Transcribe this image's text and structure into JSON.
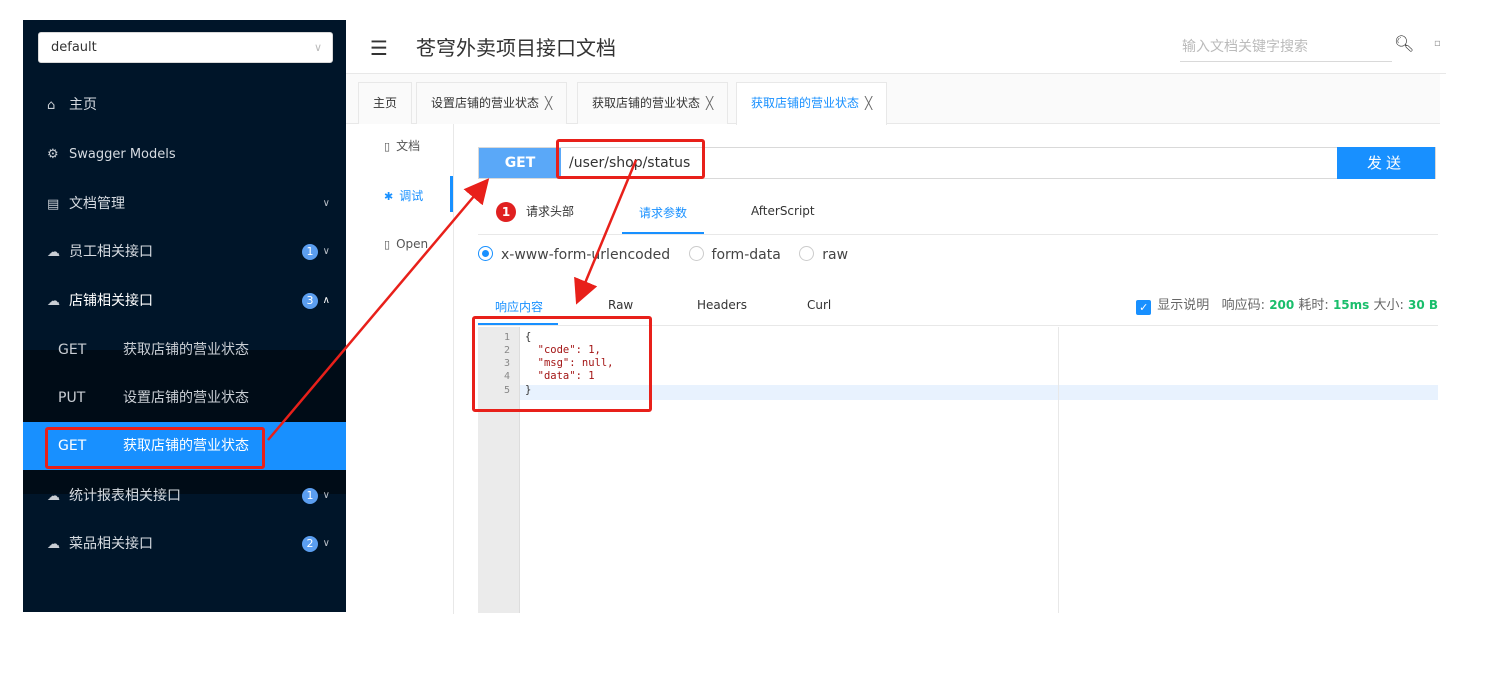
{
  "sidebar": {
    "group_select": "default",
    "menu": [
      {
        "label": "主页"
      },
      {
        "label": "Swagger Models"
      },
      {
        "label": "文档管理"
      },
      {
        "label": "员工相关接口",
        "badge": "1"
      },
      {
        "label": "店铺相关接口",
        "badge": "3"
      },
      {
        "label": "统计报表相关接口",
        "badge": "1"
      },
      {
        "label": "菜品相关接口",
        "badge": "2"
      }
    ],
    "sub_items": [
      {
        "method": "GET",
        "label": "获取店铺的营业状态"
      },
      {
        "method": "PUT",
        "label": "设置店铺的营业状态"
      },
      {
        "method": "GET",
        "label": "获取店铺的营业状态"
      }
    ]
  },
  "header": {
    "title": "苍穹外卖项目接口文档",
    "search_placeholder": "输入文档关键字搜索"
  },
  "tabs": [
    {
      "label": "主页"
    },
    {
      "label": "设置店铺的营业状态"
    },
    {
      "label": "获取店铺的营业状态"
    },
    {
      "label": "获取店铺的营业状态"
    }
  ],
  "subnav": {
    "doc": "文档",
    "debug": "调试",
    "open": "Open"
  },
  "request": {
    "method": "GET",
    "url": "/user/shop/status",
    "send": "发送"
  },
  "param_tabs": {
    "headers_badge": "1",
    "headers": "请求头部",
    "params": "请求参数",
    "after_script": "AfterScript"
  },
  "body_types": {
    "urlencoded": "x-www-form-urlencoded",
    "form_data": "form-data",
    "raw": "raw"
  },
  "response": {
    "tabs": {
      "content": "响应内容",
      "raw": "Raw",
      "headers": "Headers",
      "curl": "Curl"
    },
    "show_desc": "显示说明",
    "code_label": "响应码:",
    "code": "200",
    "time_label": "耗时:",
    "time": "15ms",
    "size_label": "大小:",
    "size": "30 B",
    "lines": [
      "1",
      "2",
      "3",
      "4",
      "5"
    ],
    "code_lines": [
      "{",
      "  \"code\": 1,",
      "  \"msg\": null,",
      "  \"data\": 1",
      "}"
    ]
  },
  "colors": {
    "accent": "#1890ff",
    "sidebar_bg": "#001529",
    "annotation": "#e8201a"
  }
}
